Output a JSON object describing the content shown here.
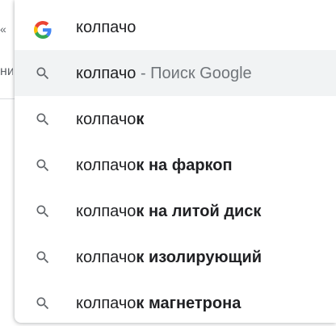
{
  "background": {
    "left_edge_glyph": "«",
    "left_edge_text": "ни"
  },
  "omnibox": {
    "query": "колпачо",
    "engine_icon": "google-g-icon"
  },
  "suggestions": [
    {
      "typed": "колпачо",
      "completion": "",
      "separator": " - ",
      "hint": "Поиск Google",
      "selected": true,
      "icon": "search-icon"
    },
    {
      "typed": "колпачо",
      "completion": "к",
      "selected": false,
      "icon": "search-icon"
    },
    {
      "typed": "колпачо",
      "completion": "к на фаркоп",
      "selected": false,
      "icon": "search-icon"
    },
    {
      "typed": "колпачо",
      "completion": "к на литой диск",
      "selected": false,
      "icon": "search-icon"
    },
    {
      "typed": "колпачо",
      "completion": "к изолирующий",
      "selected": false,
      "icon": "search-icon"
    },
    {
      "typed": "колпачо",
      "completion": "к магнетрона",
      "selected": false,
      "icon": "search-icon"
    }
  ],
  "colors": {
    "text": "#202124",
    "hint": "#70757a",
    "icon": "#5f6368",
    "selected_bg": "#f1f3f4"
  }
}
